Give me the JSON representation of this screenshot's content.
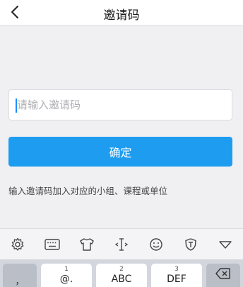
{
  "header": {
    "title": "邀请码",
    "back_icon": "chevron-left-icon"
  },
  "form": {
    "input_placeholder": "请输入邀请码",
    "input_value": "",
    "confirm_label": "确定",
    "hint": "输入邀请码加入对应的小组、课程或单位"
  },
  "colors": {
    "accent": "#1e9cf0",
    "caret": "#1e90ff",
    "background": "#f0f0f3"
  },
  "keyboard": {
    "toolbar_icons": [
      "gear-icon",
      "keyboard-icon",
      "tshirt-icon",
      "cursor-icon",
      "smiley-icon",
      "shield-t-icon",
      "triangle-down-icon"
    ],
    "keys": [
      {
        "num": "",
        "letters": "，"
      },
      {
        "num": "1",
        "letters": "@."
      },
      {
        "num": "2",
        "letters": "ABC"
      },
      {
        "num": "3",
        "letters": "DEF"
      }
    ],
    "backspace_icon": "backspace-icon"
  }
}
